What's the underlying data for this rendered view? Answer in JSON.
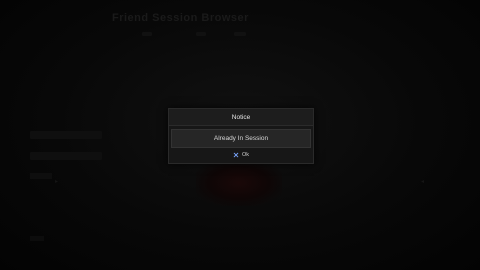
{
  "background": {
    "title": "Friend Session Browser"
  },
  "dialog": {
    "title": "Notice",
    "message": "Already In Session",
    "ok_button": {
      "icon": "cross-button-icon",
      "label": "Ok"
    }
  },
  "colors": {
    "dialog_background": "#171717",
    "dialog_header": "#1d1d1d",
    "message_panel": "#262626",
    "cross_icon": "#7aa6ff"
  }
}
